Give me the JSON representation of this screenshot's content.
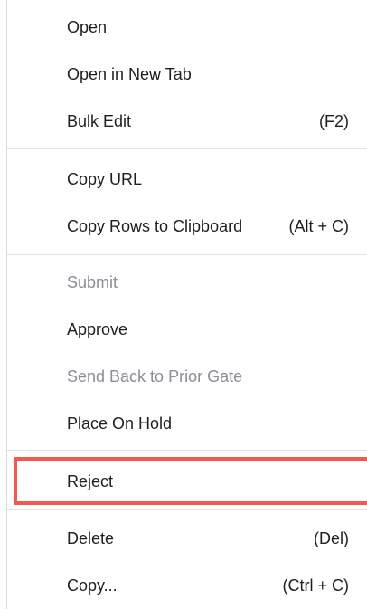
{
  "menu": {
    "items": [
      {
        "label": "Open",
        "shortcut": ""
      },
      {
        "label": "Open in New Tab",
        "shortcut": ""
      },
      {
        "label": "Bulk Edit",
        "shortcut": "(F2)"
      },
      {
        "label": "Copy URL",
        "shortcut": ""
      },
      {
        "label": "Copy Rows to Clipboard",
        "shortcut": "(Alt + C)"
      },
      {
        "label": "Submit",
        "shortcut": "",
        "disabled": true
      },
      {
        "label": "Approve",
        "shortcut": ""
      },
      {
        "label": "Send Back to Prior Gate",
        "shortcut": "",
        "disabled": true
      },
      {
        "label": "Place On Hold",
        "shortcut": ""
      },
      {
        "label": "Reject",
        "shortcut": "",
        "highlighted": true
      },
      {
        "label": "Delete",
        "shortcut": "(Del)"
      },
      {
        "label": "Copy...",
        "shortcut": "(Ctrl + C)"
      }
    ]
  },
  "colors": {
    "text": "#1f1f1f",
    "disabled_text": "#8a8f96",
    "divider": "#dfe3e8",
    "highlight_border": "#f15a4f"
  }
}
